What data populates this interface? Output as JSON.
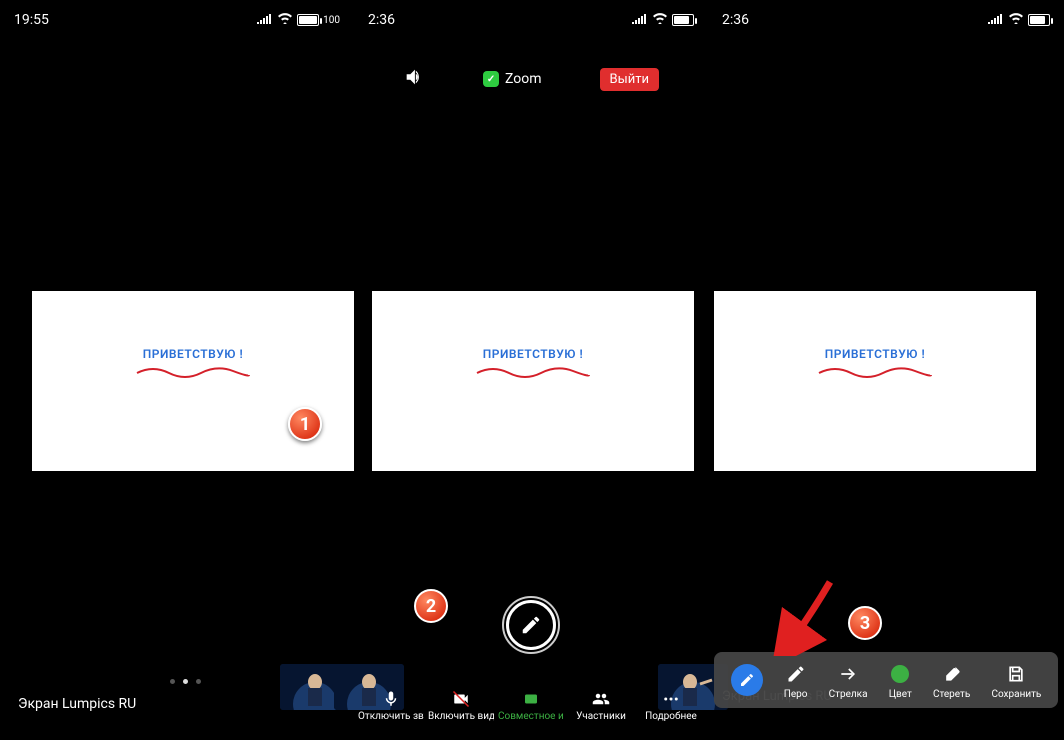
{
  "panel1": {
    "status_time": "19:55",
    "status_battery": "100",
    "screen_label": "Экран Lumpics RU",
    "greeting": "ПРИВЕТСТВУЮ !"
  },
  "panel2": {
    "status_time": "2:36",
    "zoom_title": "Zoom",
    "exit_label": "Выйти",
    "greeting": "ПРИВЕТСТВУЮ !",
    "toolbar": {
      "mute": "Отключить зву",
      "video": "Включить виде",
      "share": "Совместное ис",
      "participants": "Участники",
      "more": "Подробнее"
    }
  },
  "panel3": {
    "status_time": "2:36",
    "greeting": "ПРИВЕТСТВУЮ !",
    "screen_label": "Экран Lumpics RU",
    "anno": {
      "pen": "Перо",
      "arrow": "Стрелка",
      "color": "Цвет",
      "erase": "Стереть",
      "save": "Сохранить"
    }
  },
  "steps": {
    "s1": "1",
    "s2": "2",
    "s3": "3"
  }
}
